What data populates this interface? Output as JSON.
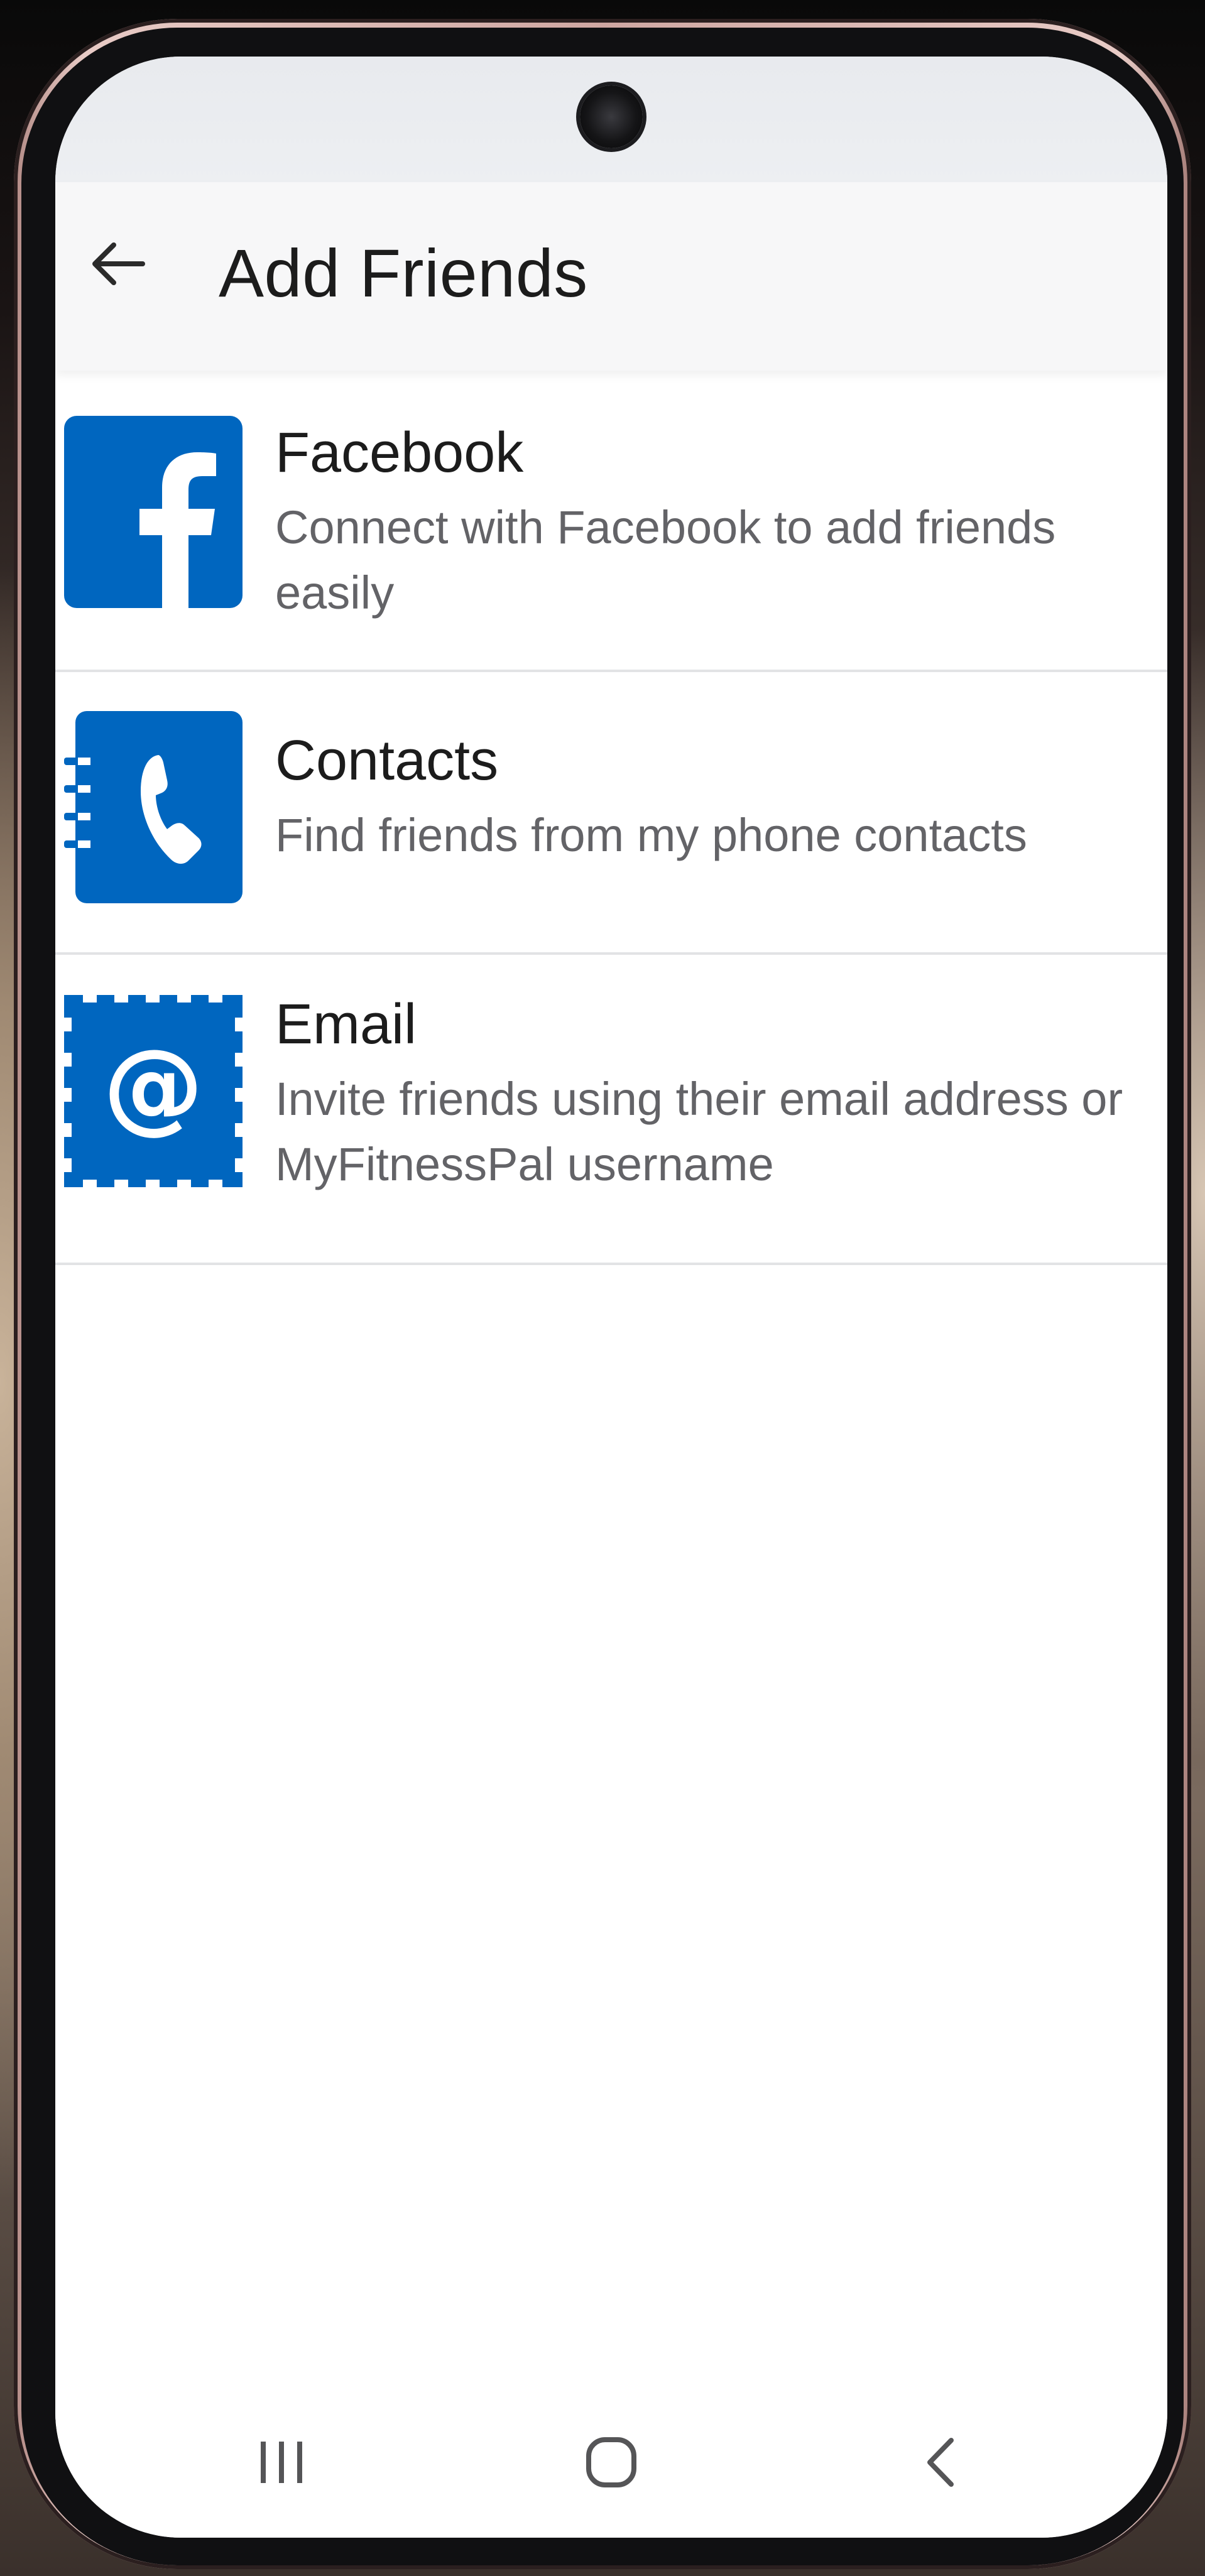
{
  "header": {
    "title": "Add Friends",
    "back_icon": "arrow-left-icon"
  },
  "options": [
    {
      "title": "Facebook",
      "subtitle": "Connect with Facebook to add friends easily",
      "icon": "facebook-icon",
      "icon_color": "#0066bf"
    },
    {
      "title": "Contacts",
      "subtitle": "Find friends from my phone contacts",
      "icon": "phone-contacts-icon",
      "icon_color": "#0066bf"
    },
    {
      "title": "Email",
      "subtitle": "Invite friends using their email address or MyFitnessPal username",
      "icon": "email-at-stamp-icon",
      "icon_color": "#0066bf"
    }
  ],
  "navigation": {
    "recents_icon": "recent-apps-icon",
    "home_icon": "home-icon",
    "back_icon": "back-chevron-icon"
  },
  "colors": {
    "accent": "#0066bf",
    "title_text": "#1c1c1c",
    "subtitle_text": "#636367",
    "divider": "#e2e3e5",
    "app_bar": "#f7f7f8"
  }
}
